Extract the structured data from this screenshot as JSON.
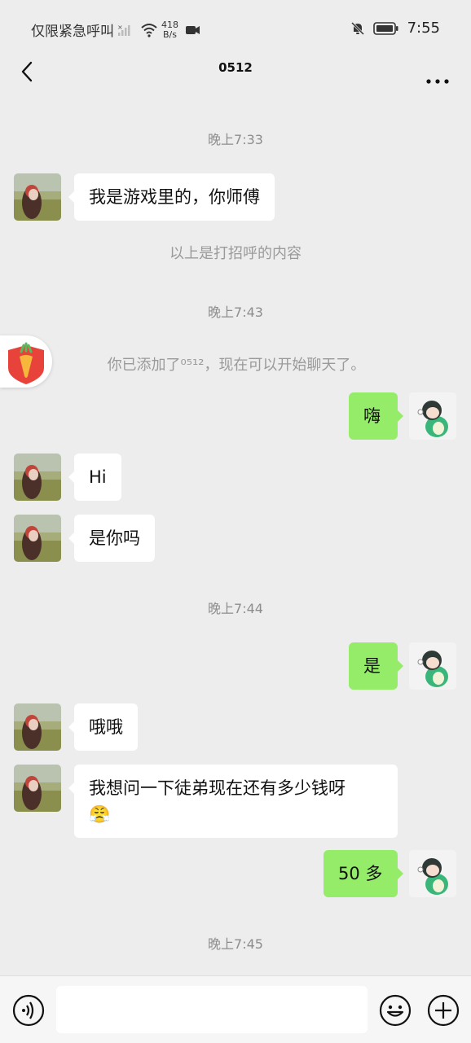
{
  "status_bar": {
    "carrier_text": "仅限紧急呼叫",
    "net_speed_value": "418",
    "net_speed_unit": "B/s",
    "time": "7:55"
  },
  "header": {
    "title": "0512"
  },
  "messages": {
    "time_1": "晚上7:33",
    "msg_1": "我是游戏里的，你师傅",
    "greeting_note": "以上是打招呼的内容",
    "time_2": "晚上7:43",
    "added_notice": "你已添加了⁰⁵¹²，现在可以开始聊天了。",
    "msg_2": "嗨",
    "msg_3": "Hi",
    "msg_4": "是你吗",
    "time_3": "晚上7:44",
    "msg_5": "是",
    "msg_6": "哦哦",
    "msg_7": "我想问一下徒弟现在还有多少钱呀",
    "msg_7_emoji": "😤",
    "msg_8": "50 多",
    "time_4": "晚上7:45"
  },
  "input_bar": {
    "placeholder": ""
  },
  "icons": {
    "back": "back-arrow-icon",
    "more": "more-dots-icon",
    "voice": "voice-icon",
    "emoji": "emoji-icon",
    "plus": "plus-icon"
  },
  "colors": {
    "background": "#ededed",
    "bubble_self": "#95ec69",
    "bubble_other": "#ffffff",
    "time_text": "#8d8d8d"
  }
}
